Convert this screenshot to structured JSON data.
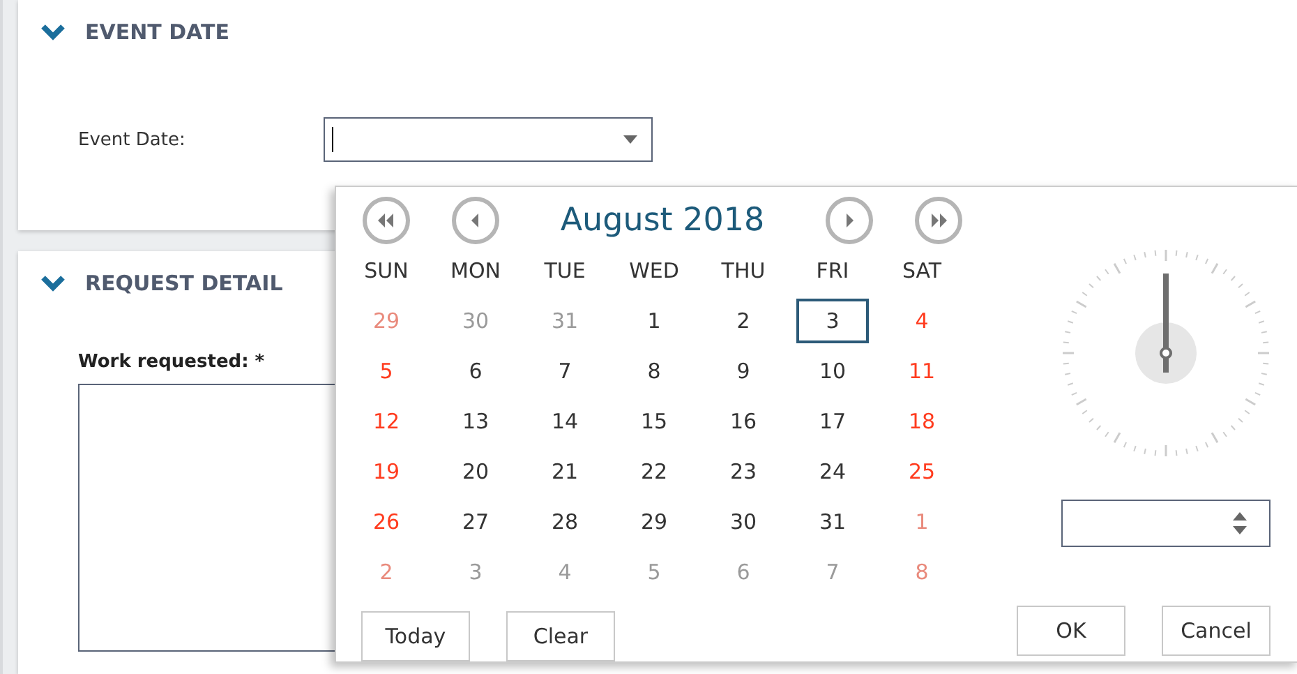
{
  "sections": [
    {
      "title": "EVENT DATE",
      "expanded": true
    },
    {
      "title": "REQUEST DETAIL",
      "expanded": true
    }
  ],
  "event_date": {
    "label": "Event Date:"
  },
  "work_requested": {
    "label": "Work requested: *"
  },
  "calendar": {
    "month_title": "August 2018",
    "weekdays": [
      "SUN",
      "MON",
      "TUE",
      "WED",
      "THU",
      "FRI",
      "SAT"
    ],
    "weeks": [
      [
        {
          "label": "29",
          "other_month": true,
          "weekend": true,
          "selected": false
        },
        {
          "label": "30",
          "other_month": true,
          "weekend": false,
          "selected": false
        },
        {
          "label": "31",
          "other_month": true,
          "weekend": false,
          "selected": false
        },
        {
          "label": "1",
          "other_month": false,
          "weekend": false,
          "selected": false
        },
        {
          "label": "2",
          "other_month": false,
          "weekend": false,
          "selected": false
        },
        {
          "label": "3",
          "other_month": false,
          "weekend": false,
          "selected": true
        },
        {
          "label": "4",
          "other_month": false,
          "weekend": true,
          "selected": false
        }
      ],
      [
        {
          "label": "5",
          "other_month": false,
          "weekend": true,
          "selected": false
        },
        {
          "label": "6",
          "other_month": false,
          "weekend": false,
          "selected": false
        },
        {
          "label": "7",
          "other_month": false,
          "weekend": false,
          "selected": false
        },
        {
          "label": "8",
          "other_month": false,
          "weekend": false,
          "selected": false
        },
        {
          "label": "9",
          "other_month": false,
          "weekend": false,
          "selected": false
        },
        {
          "label": "10",
          "other_month": false,
          "weekend": false,
          "selected": false
        },
        {
          "label": "11",
          "other_month": false,
          "weekend": true,
          "selected": false
        }
      ],
      [
        {
          "label": "12",
          "other_month": false,
          "weekend": true,
          "selected": false
        },
        {
          "label": "13",
          "other_month": false,
          "weekend": false,
          "selected": false
        },
        {
          "label": "14",
          "other_month": false,
          "weekend": false,
          "selected": false
        },
        {
          "label": "15",
          "other_month": false,
          "weekend": false,
          "selected": false
        },
        {
          "label": "16",
          "other_month": false,
          "weekend": false,
          "selected": false
        },
        {
          "label": "17",
          "other_month": false,
          "weekend": false,
          "selected": false
        },
        {
          "label": "18",
          "other_month": false,
          "weekend": true,
          "selected": false
        }
      ],
      [
        {
          "label": "19",
          "other_month": false,
          "weekend": true,
          "selected": false
        },
        {
          "label": "20",
          "other_month": false,
          "weekend": false,
          "selected": false
        },
        {
          "label": "21",
          "other_month": false,
          "weekend": false,
          "selected": false
        },
        {
          "label": "22",
          "other_month": false,
          "weekend": false,
          "selected": false
        },
        {
          "label": "23",
          "other_month": false,
          "weekend": false,
          "selected": false
        },
        {
          "label": "24",
          "other_month": false,
          "weekend": false,
          "selected": false
        },
        {
          "label": "25",
          "other_month": false,
          "weekend": true,
          "selected": false
        }
      ],
      [
        {
          "label": "26",
          "other_month": false,
          "weekend": true,
          "selected": false
        },
        {
          "label": "27",
          "other_month": false,
          "weekend": false,
          "selected": false
        },
        {
          "label": "28",
          "other_month": false,
          "weekend": false,
          "selected": false
        },
        {
          "label": "29",
          "other_month": false,
          "weekend": false,
          "selected": false
        },
        {
          "label": "30",
          "other_month": false,
          "weekend": false,
          "selected": false
        },
        {
          "label": "31",
          "other_month": false,
          "weekend": false,
          "selected": false
        },
        {
          "label": "1",
          "other_month": true,
          "weekend": true,
          "selected": false
        }
      ],
      [
        {
          "label": "2",
          "other_month": true,
          "weekend": true,
          "selected": false
        },
        {
          "label": "3",
          "other_month": true,
          "weekend": false,
          "selected": false
        },
        {
          "label": "4",
          "other_month": true,
          "weekend": false,
          "selected": false
        },
        {
          "label": "5",
          "other_month": true,
          "weekend": false,
          "selected": false
        },
        {
          "label": "6",
          "other_month": true,
          "weekend": false,
          "selected": false
        },
        {
          "label": "7",
          "other_month": true,
          "weekend": false,
          "selected": false
        },
        {
          "label": "8",
          "other_month": true,
          "weekend": true,
          "selected": false
        }
      ]
    ]
  },
  "footer_buttons": [
    "Today",
    "Clear"
  ],
  "dialog_buttons": [
    "OK",
    "Cancel"
  ]
}
